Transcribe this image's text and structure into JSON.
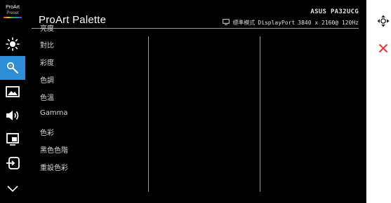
{
  "logo": {
    "line1": "ProArt",
    "line2": "Preset"
  },
  "header": {
    "title": "ProArt Palette",
    "model": "ASUS PA32UCG",
    "mode": "標準模式",
    "input": "DisplayPort",
    "resolution": "3840 x 2160@  120Hz"
  },
  "sidebar": {
    "items": [
      {
        "icon": "brightness-icon"
      },
      {
        "icon": "palette-icon",
        "active": true
      },
      {
        "icon": "image-icon"
      },
      {
        "icon": "sound-icon"
      },
      {
        "icon": "pip-icon"
      },
      {
        "icon": "input-select-icon"
      },
      {
        "icon": "chevron-down-icon"
      }
    ]
  },
  "menu": {
    "items": [
      {
        "label": "亮度"
      },
      {
        "label": "對比"
      },
      {
        "label": "彩度"
      },
      {
        "label": "色調"
      },
      {
        "label": "色溫"
      },
      {
        "label": "Gamma"
      },
      {
        "label": "色彩"
      },
      {
        "label": "黑色色階"
      },
      {
        "label": "重設色彩"
      }
    ]
  },
  "side_controls": {
    "navigate": "navigate-icon",
    "close": "close-icon"
  },
  "colors": {
    "accent": "#2f8fd6",
    "close": "#e53935",
    "background": "#000000"
  }
}
